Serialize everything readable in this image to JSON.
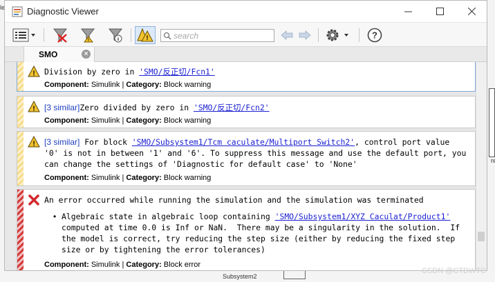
{
  "window": {
    "title": "Diagnostic Viewer",
    "icon": "matlab-diagnostic-icon"
  },
  "toolbar": {
    "search_placeholder": "search",
    "icons": [
      "list-view-icon",
      "clear-filter-icon",
      "filter-icon",
      "filter-info-icon",
      "warning-toggle-icon",
      "back-arrow-icon",
      "forward-arrow-icon",
      "gear-icon",
      "help-icon"
    ]
  },
  "tabs": [
    {
      "label": "SMO"
    }
  ],
  "messages": [
    {
      "type": "warning",
      "similar": "",
      "text_before": "Division by zero in ",
      "link": "'SMO/反正切/Fcn1'",
      "component_label": "Component:",
      "component": "Simulink",
      "separator": "|",
      "category_label": "Category:",
      "category": "Block warning"
    },
    {
      "type": "warning",
      "similar": "[3 similar]",
      "text_before": "Zero divided by zero in ",
      "link": "'SMO/反正切/Fcn2'",
      "component_label": "Component:",
      "component": "Simulink",
      "separator": "|",
      "category_label": "Category:",
      "category": "Block warning"
    },
    {
      "type": "warning",
      "similar": "[3 similar]",
      "text_before": "For block ",
      "link": "'SMO/Subsystem1/Tcm caculate/Multiport Switch2'",
      "text_after": ", control port value",
      "line2": "'0' is not in between '1' and '6'. To suppress this message and use the default port, you",
      "line3": "can change the settings of 'Diagnostic for default case' to 'None'",
      "component_label": "Component:",
      "component": "Simulink",
      "separator": "|",
      "category_label": "Category:",
      "category": "Block warning"
    },
    {
      "type": "error",
      "headline": "An error occurred while running the simulation and the simulation was terminated",
      "bullet": "•",
      "detail_before": "Algebraic state in algebraic loop containing ",
      "detail_link": "'SMO/Subsystem1/XYZ Caculat/Product1'",
      "detail_line2": "computed at time 0.0 is Inf or NaN.  There may be a singularity in the solution.  If",
      "detail_line3": "the model is correct, try reducing the step size (either by reducing the fixed step",
      "detail_line4": "size or by tightening the error tolerances)",
      "component_label": "Component:",
      "component": "Simulink",
      "separator": "|",
      "category_label": "Category:",
      "category": "Block error"
    }
  ],
  "background": {
    "left_mark": "le",
    "right_mark": "re",
    "subsystem_label": "Subsystem2",
    "watermark": "CSDN @CTDWTC"
  },
  "colors": {
    "warning_stripe": "#f7dc8b",
    "error_stripe": "#d43c3c",
    "link": "#1a1fd1",
    "similar": "#1f3fbf"
  }
}
